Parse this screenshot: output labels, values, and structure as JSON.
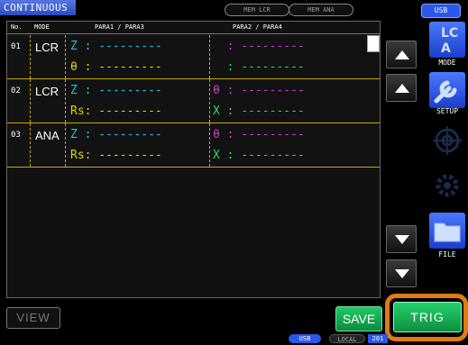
{
  "header": {
    "title": "CONTINUOUS",
    "mem_lcr": "MEM LCR",
    "mem_ana": "MEM ANA",
    "usb": "USB"
  },
  "table": {
    "headers": {
      "no": "No.",
      "mode": "MODE",
      "para13": "PARA1 / PARA3",
      "para24": "PARA2 / PARA4"
    },
    "rows": [
      {
        "no": "01",
        "mode": "LCR",
        "p1": "Z : ---------",
        "p3": "θ : ---------",
        "p2": "  : ---------",
        "p4": "  : ---------",
        "colors": {
          "p1": "#19c7e0",
          "p3": "#e3d400",
          "p2": "#c53ed6",
          "p4": "#2bd86a"
        }
      },
      {
        "no": "02",
        "mode": "LCR",
        "p1": "Z : ---------",
        "p3": "Rs: ---------",
        "p2": "θ : ---------",
        "p4": "X : ---------",
        "colors": {
          "p1": "#19c7e0",
          "p3": "#e3d400",
          "p2": "#c53ed6",
          "p4": "#2bd86a"
        }
      },
      {
        "no": "03",
        "mode": "ANA",
        "p1": "Z : ---------",
        "p3": "Rs: ---------",
        "p2": "θ : ---------",
        "p4": "X : ---------",
        "colors": {
          "p1": "#19c7e0",
          "p3": "#e3d400",
          "p2": "#c53ed6",
          "p4": "#2bd86a"
        }
      }
    ]
  },
  "side": {
    "mode_label": "MODE",
    "setup_label": "SETUP",
    "file_label": "FILE",
    "mode_icon_text": "LC\nA"
  },
  "footer": {
    "view": "VIEW",
    "save": "SAVE",
    "trig": "TRIG",
    "usb": "USB",
    "local": "LOCAL",
    "year": "201"
  },
  "colors": {
    "accent": "#2b58e8",
    "trig_highlight": "#e07a12",
    "row_divider": "#c8a900",
    "save_green": "#1aa955"
  }
}
